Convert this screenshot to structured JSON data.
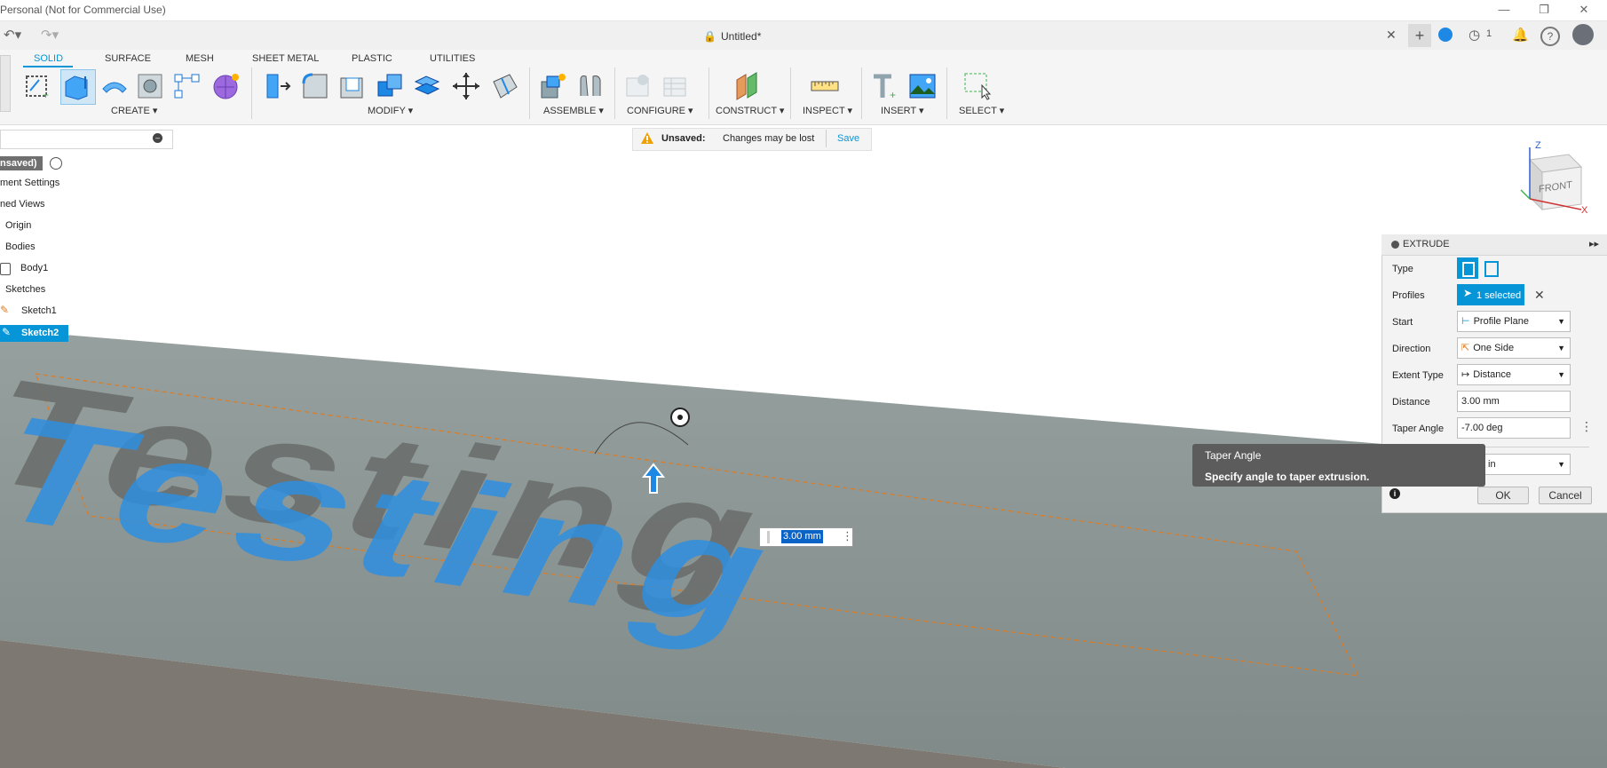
{
  "app": {
    "title": "Personal (Not for Commercial Use)",
    "document_title": "Untitled*",
    "notification_count": "1"
  },
  "workspace_tabs": [
    "SOLID",
    "SURFACE",
    "MESH",
    "SHEET METAL",
    "PLASTIC",
    "UTILITIES"
  ],
  "ribbon_groups": {
    "create": "CREATE ▾",
    "modify": "MODIFY ▾",
    "assemble": "ASSEMBLE ▾",
    "configure": "CONFIGURE ▾",
    "construct": "CONSTRUCT ▾",
    "inspect": "INSPECT ▾",
    "insert": "INSERT ▾",
    "select": "SELECT ▾"
  },
  "warning": {
    "label": "Unsaved:",
    "message": "Changes may be lost",
    "save": "Save"
  },
  "browser": {
    "root": "nsaved)",
    "items": [
      "ment Settings",
      "ned Views",
      "Origin",
      "Bodies",
      "Body1",
      "Sketches",
      "Sketch1",
      "Sketch2"
    ]
  },
  "viewcube": {
    "face": "FRONT",
    "z": "Z",
    "x": "X"
  },
  "viewport": {
    "model_text": "Testing",
    "distance_input": "3.00 mm"
  },
  "extrude": {
    "title": "EXTRUDE",
    "type_label": "Type",
    "profiles_label": "Profiles",
    "profiles_value": "1 selected",
    "start_label": "Start",
    "start_value": "Profile Plane",
    "direction_label": "Direction",
    "direction_value": "One Side",
    "extent_label": "Extent Type",
    "extent_value": "Distance",
    "distance_label": "Distance",
    "distance_value": "3.00 mm",
    "taper_label": "Taper Angle",
    "taper_value": "-7.00 deg",
    "operation_partial": "in",
    "ok": "OK",
    "cancel": "Cancel"
  },
  "tooltip": {
    "title": "Taper Angle",
    "text": "Specify angle to taper extrusion."
  },
  "colors": {
    "accent": "#0696d7",
    "selection_blue": "#1e88e5",
    "ground": "#8f9896"
  }
}
